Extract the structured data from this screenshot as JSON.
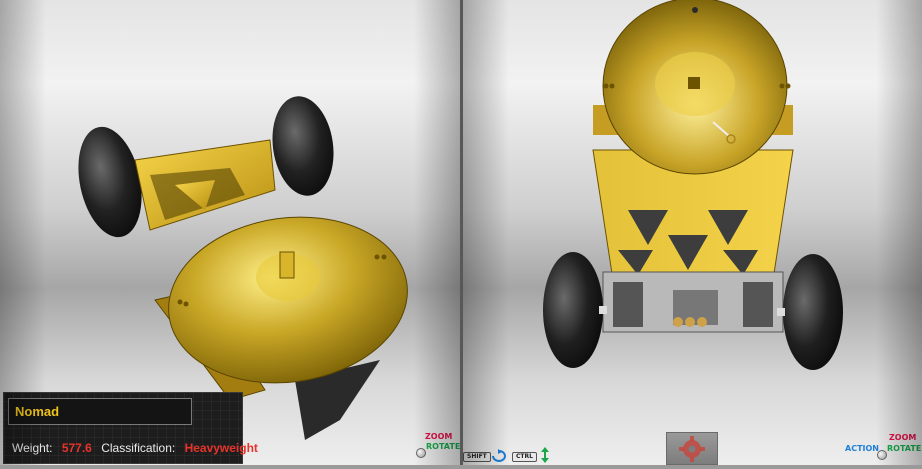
{
  "robot": {
    "name": "Nomad",
    "weight_label": "Weight:",
    "weight_value": "577.6",
    "classification_label": "Classification:",
    "classification_value": "Heavyweight"
  },
  "left_controls": {
    "zoom_label": "ZOOM",
    "rotate_label": "ROTATE"
  },
  "right_controls": {
    "shift_key": "SHIFT",
    "ctrl_key": "CTRL",
    "action_label": "ACTION",
    "zoom_label": "ZOOM",
    "rotate_label": "ROTATE"
  },
  "colors": {
    "robot_name": "#f0c419",
    "stat_value": "#e8332a",
    "zoom": "#e0104a",
    "rotate": "#18a84a",
    "action": "#1e7fd8"
  }
}
